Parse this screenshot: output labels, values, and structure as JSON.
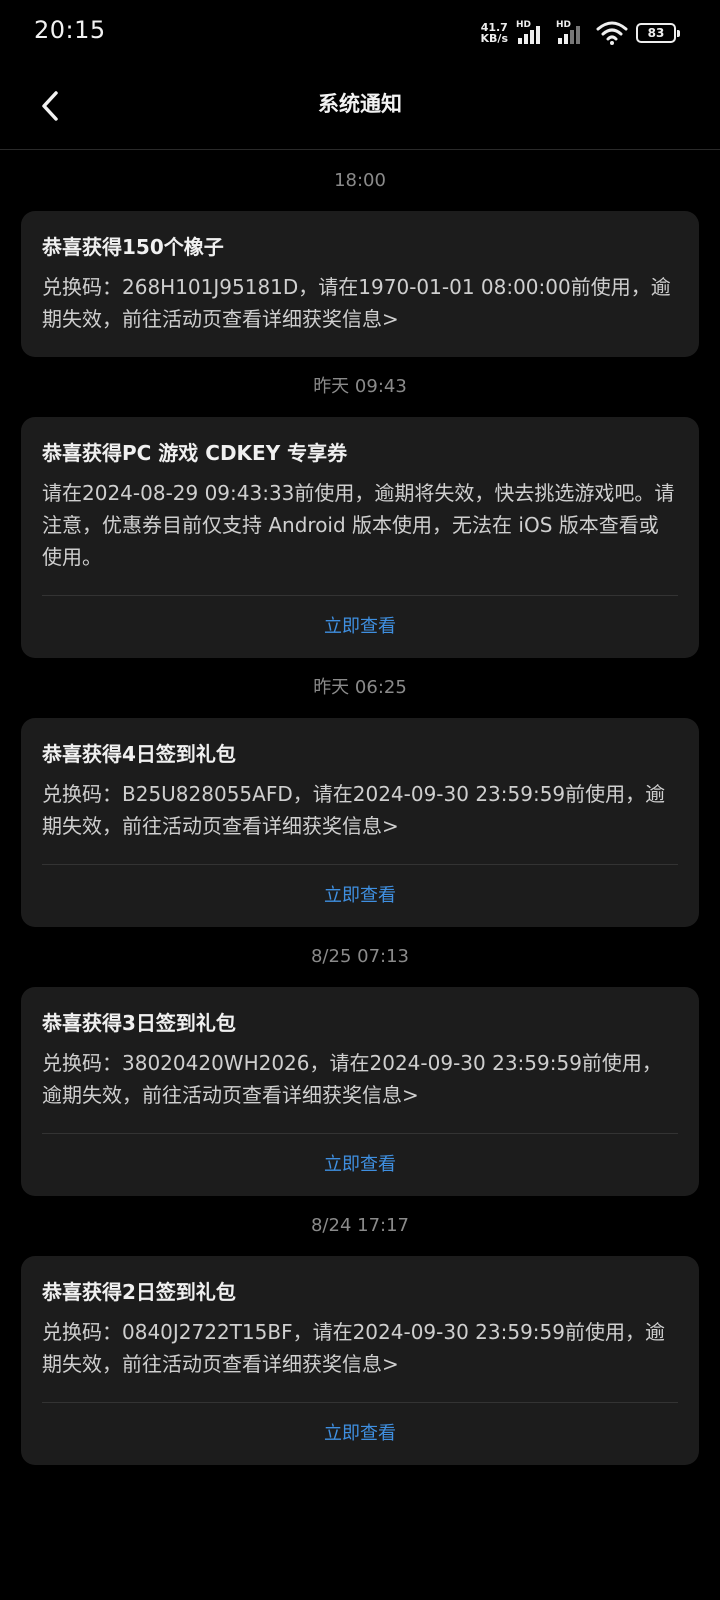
{
  "status_bar": {
    "time": "20:15",
    "net_speed_value": "41.7",
    "net_speed_unit": "KB/s",
    "sim1_label": "HD",
    "sim2_label": "HD",
    "battery": "83"
  },
  "header": {
    "title": "系统通知"
  },
  "notifications": [
    {
      "time": "18:00",
      "title": "恭喜获得150个橡子",
      "body": "兑换码：268H101J95181D，请在1970-01-01 08:00:00前使用，逾期失效，前往活动页查看详细获奖信息>",
      "action": ""
    },
    {
      "time": "昨天  09:43",
      "title": "恭喜获得PC 游戏 CDKEY 专享券",
      "body": "请在2024-08-29 09:43:33前使用，逾期将失效，快去挑选游戏吧。请注意，优惠券目前仅支持 Android 版本使用，无法在 iOS 版本查看或使用。",
      "action": "立即查看"
    },
    {
      "time": "昨天  06:25",
      "title": "恭喜获得4日签到礼包",
      "body": "兑换码：B25U828055AFD，请在2024-09-30 23:59:59前使用，逾期失效，前往活动页查看详细获奖信息>",
      "action": "立即查看"
    },
    {
      "time": "8/25  07:13",
      "title": "恭喜获得3日签到礼包",
      "body": "兑换码：38020420WH2026，请在2024-09-30 23:59:59前使用，逾期失效，前往活动页查看详细获奖信息>",
      "action": "立即查看"
    },
    {
      "time": "8/24  17:17",
      "title": "恭喜获得2日签到礼包",
      "body": "兑换码：0840J2722T15BF，请在2024-09-30 23:59:59前使用，逾期失效，前往活动页查看详细获奖信息>",
      "action": "立即查看"
    }
  ],
  "colors": {
    "background": "#000000",
    "card": "#1c1c1c",
    "link": "#3f8fe0",
    "timestamp": "#8a8a8a"
  },
  "icons": [
    "back-arrow-icon",
    "signal-icon",
    "wifi-icon",
    "battery-icon"
  ]
}
